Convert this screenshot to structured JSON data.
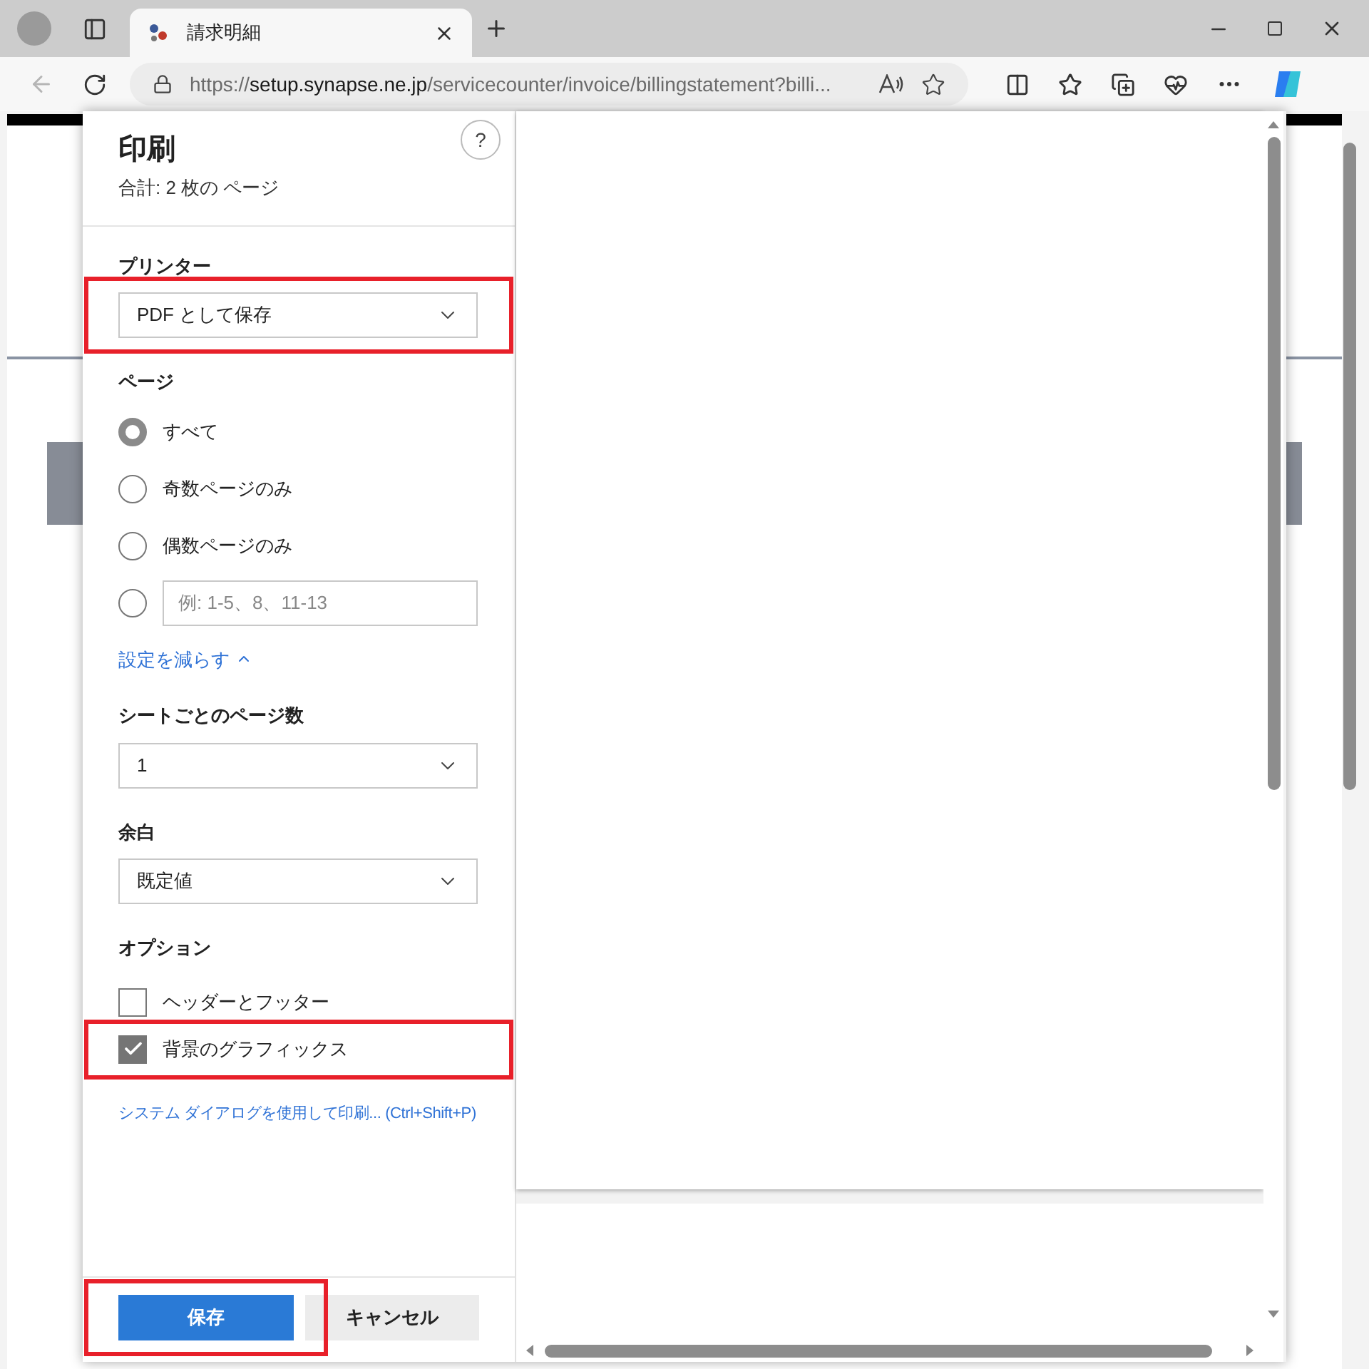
{
  "browser": {
    "tab": {
      "title": "請求明細",
      "selected": true
    },
    "address": {
      "scheme": "https://",
      "host": "setup.synapse.ne.jp",
      "rest": "/servicecounter/invoice/billingstatement?billi..."
    }
  },
  "print_dialog": {
    "title": "印刷",
    "subtitle": "合計: 2 枚の ページ",
    "help": "?",
    "printer": {
      "label": "プリンター",
      "value": "PDF として保存",
      "highlighted": true
    },
    "pages": {
      "label": "ページ",
      "options": [
        {
          "kind": "radio",
          "label": "すべて",
          "selected": true
        },
        {
          "kind": "radio",
          "label": "奇数ページのみ",
          "selected": false
        },
        {
          "kind": "radio",
          "label": "偶数ページのみ",
          "selected": false
        },
        {
          "kind": "range",
          "placeholder": "例: 1-5、8、11-13",
          "selected": false
        }
      ]
    },
    "fewer_settings_link": "設定を減らす",
    "pages_per_sheet": {
      "label": "シートごとのページ数",
      "value": "1"
    },
    "margins": {
      "label": "余白",
      "value": "既定値"
    },
    "options": {
      "label": "オプション",
      "items": [
        {
          "label": "ヘッダーとフッター",
          "checked": false,
          "highlighted": false
        },
        {
          "label": "背景のグラフィックス",
          "checked": true,
          "highlighted": true
        }
      ]
    },
    "system_dialog_link": "システム ダイアログを使用して印刷... (Ctrl+Shift+P)",
    "buttons": [
      {
        "kind": "primary",
        "label": "保存",
        "highlighted": true
      },
      {
        "kind": "secondary",
        "label": "キャンセル",
        "highlighted": false
      }
    ]
  }
}
